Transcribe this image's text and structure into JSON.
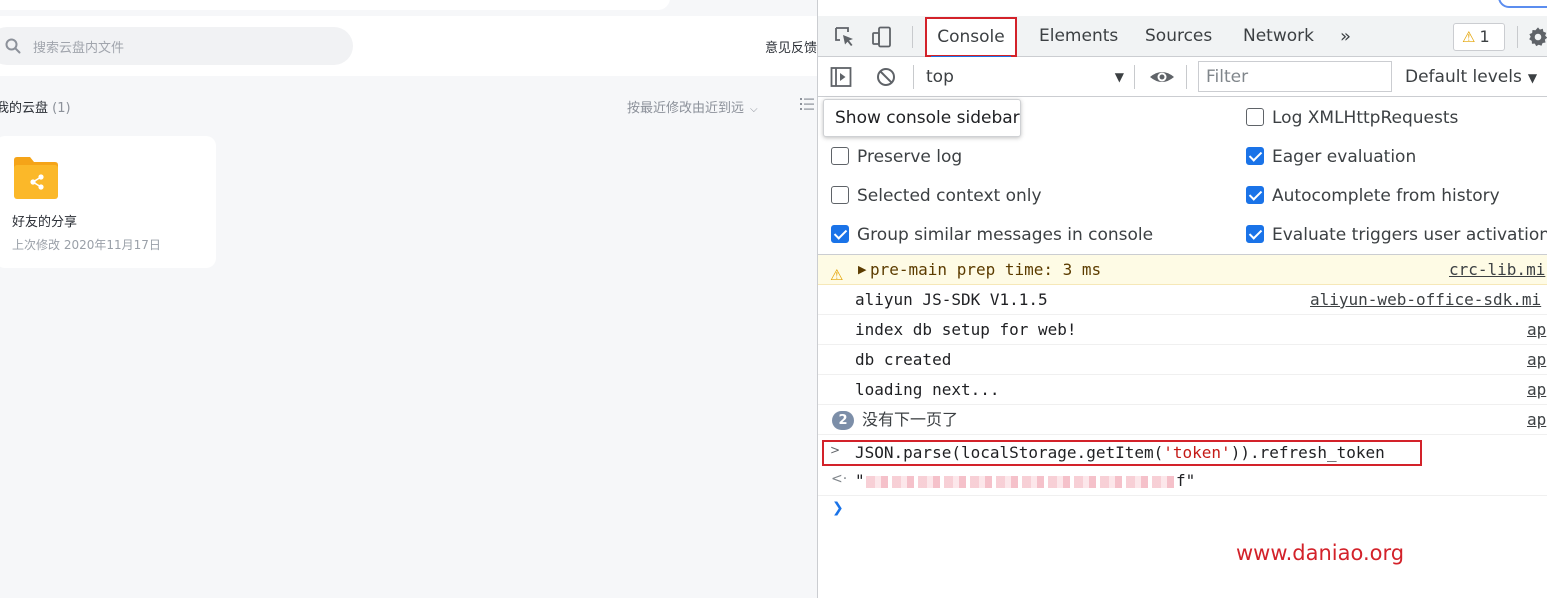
{
  "app": {
    "search": {
      "placeholder": "搜索云盘内文件"
    },
    "feedback_label": "意见反馈",
    "breadcrumb": {
      "title": "我的云盘",
      "count": "(1)"
    },
    "sort_label": "按最近修改由近到远",
    "folders": [
      {
        "name": "好友的分享",
        "meta": "上次修改 2020年11月17日"
      }
    ]
  },
  "devtools": {
    "tabs": {
      "console": "Console",
      "elements": "Elements",
      "sources": "Sources",
      "network": "Network",
      "more": "»"
    },
    "warning_count": "1",
    "toolbar": {
      "context": "top",
      "filter_placeholder": "Filter",
      "levels": "Default levels"
    },
    "tooltip": "Show console sidebar",
    "settings": [
      {
        "label": "Preserve log",
        "checked": false
      },
      {
        "label": "Selected context only",
        "checked": false
      },
      {
        "label": "Group similar messages in console",
        "checked": true
      },
      {
        "label": "Log XMLHttpRequests",
        "checked": false
      },
      {
        "label": "Eager evaluation",
        "checked": true
      },
      {
        "label": "Autocomplete from history",
        "checked": true
      },
      {
        "label": "Evaluate triggers user activation",
        "checked": true
      }
    ],
    "messages": [
      {
        "text": "pre-main prep time: 3 ms",
        "source": "crc-lib.mi"
      },
      {
        "text": "aliyun JS-SDK V1.1.5",
        "source": "aliyun-web-office-sdk.mi"
      },
      {
        "text": "index db setup for web!",
        "source": "ap"
      },
      {
        "text": "db created",
        "source": "ap"
      },
      {
        "text": "loading next...",
        "source": "ap"
      },
      {
        "text": "没有下一页了",
        "source": "ap",
        "repeat": "2"
      }
    ],
    "input": {
      "prefix": "JSON.parse(localStorage.getItem(",
      "string": "'token'",
      "suffix": ")).refresh_token"
    },
    "result": {
      "open": "\"",
      "close": "f\""
    }
  },
  "watermark": "www.daniao.org",
  "colors": {
    "highlight": "#d3222a",
    "accent": "#1a73e8",
    "warning": "#e3a200"
  }
}
